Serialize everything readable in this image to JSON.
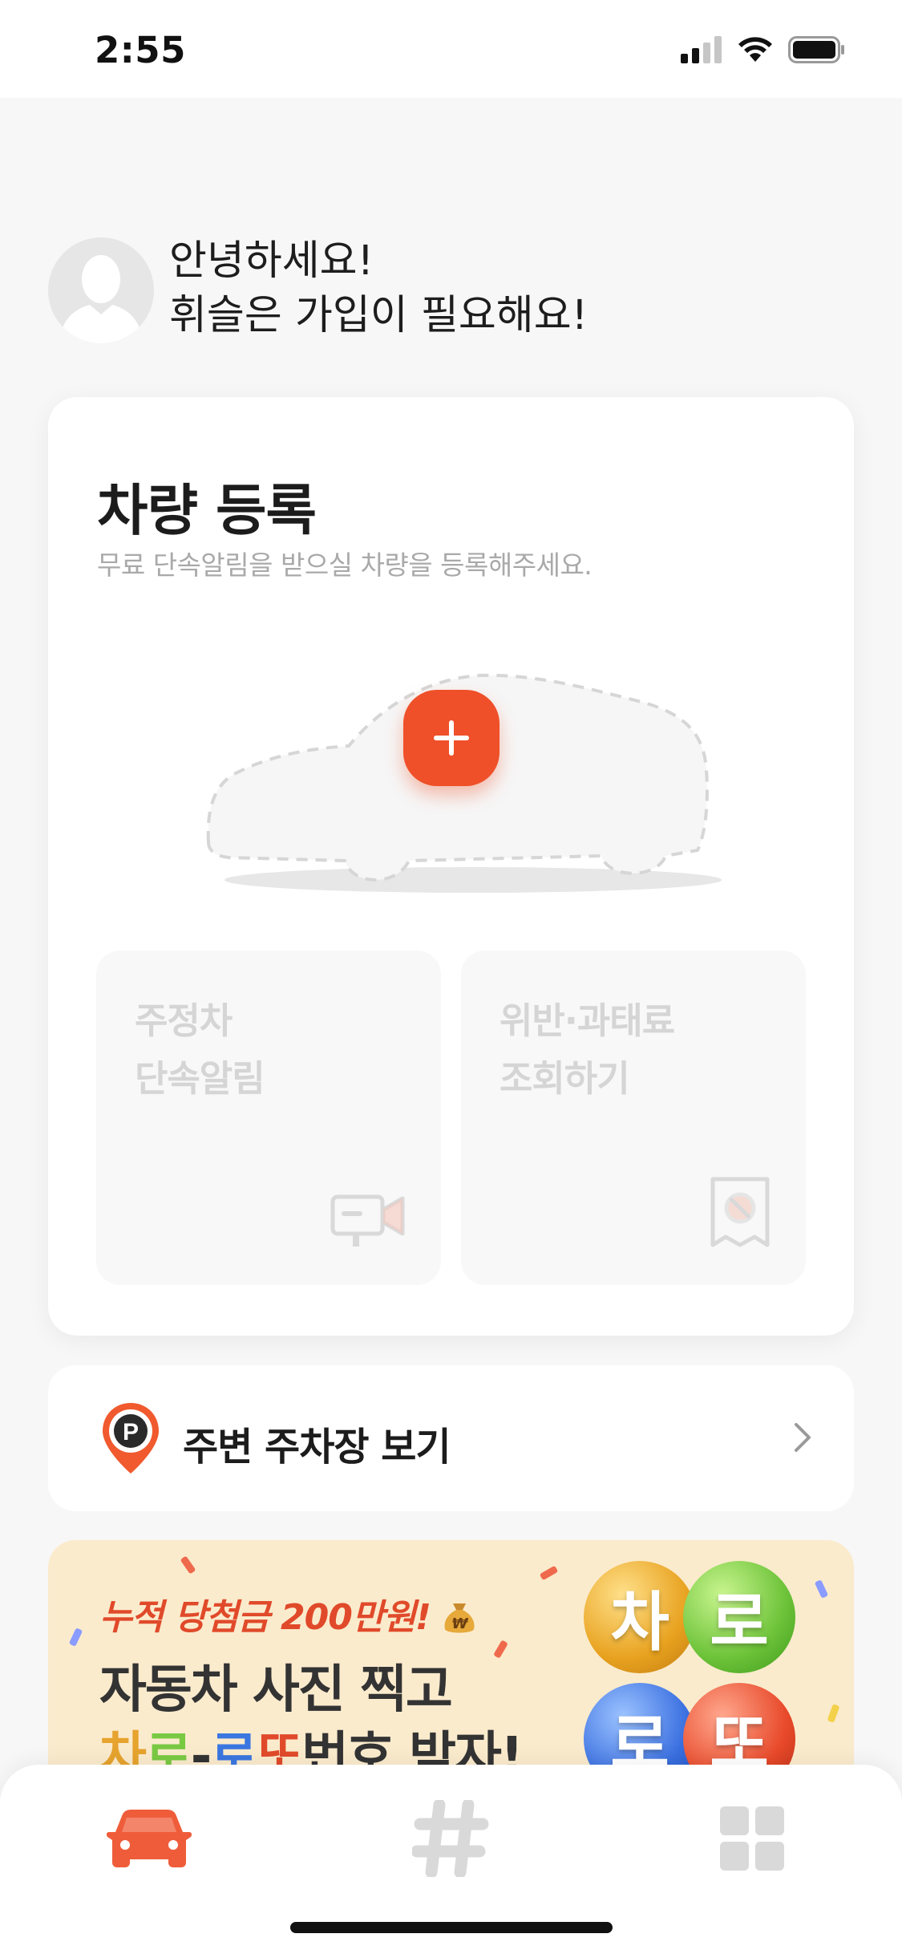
{
  "status_bar": {
    "time": "2:55"
  },
  "greeting": {
    "line1": "안녕하세요!",
    "line2": "휘슬은 가입이 필요해요!"
  },
  "vehicle_card": {
    "title": "차량 등록",
    "subtitle": "무료 단속알림을 받으실 차량을 등록해주세요.",
    "features": [
      {
        "label": "주정차\n단속알림",
        "icon": "video-camera-icon"
      },
      {
        "label": "위반·과태료\n조회하기",
        "icon": "receipt-ban-icon"
      }
    ]
  },
  "parking": {
    "label": "주변 주차장 보기",
    "icon": "parking-pin-icon"
  },
  "banner": {
    "line1": "누적 당첨금 200만원!",
    "line2": "자동차 사진 찍고",
    "line3_part1": "차",
    "line3_part2": "로",
    "line3_part3": "-",
    "line3_part4": "로",
    "line3_part5": "또",
    "line3_part6": "번호 받자!",
    "balls": [
      "차",
      "로",
      "로",
      "또"
    ]
  },
  "tab_bar": {
    "tabs": [
      {
        "icon": "car-icon",
        "active": true
      },
      {
        "icon": "hashtag-icon",
        "active": false
      },
      {
        "icon": "grid-icon",
        "active": false
      }
    ]
  },
  "colors": {
    "accent": "#ef5029",
    "background": "#f7f7f7",
    "card": "#ffffff",
    "inactive": "#d9d9d9",
    "banner_bg": "#fbebcd"
  }
}
